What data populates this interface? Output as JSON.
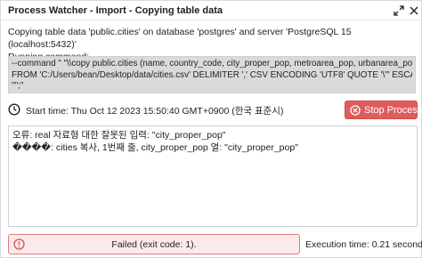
{
  "window": {
    "title": "Process Watcher - Import - Copying table data"
  },
  "description": {
    "line1": "Copying table data 'public.cities' on database 'postgres' and server 'PostgreSQL 15 (localhost:5432)'",
    "line2": "Running command:"
  },
  "command": {
    "line1": "--command \" \"\\\\copy public.cities (name, country_code, city_proper_pop, metroarea_pop, urbanarea_pop)",
    "line2": "FROM 'C:/Users/bean/Desktop/data/cities.csv' DELIMITER ',' CSV ENCODING 'UTF8' QUOTE '\\\"' ESCAPE",
    "line3": "'\"';\""
  },
  "start": {
    "label": "Start time: Thu Oct 12 2023 15:50:40 GMT+0900 (한국 표준시)",
    "icon": "clock-icon"
  },
  "stop_button": {
    "label": "Stop Process",
    "icon": "stop-circle-icon",
    "color": "#df5c5c"
  },
  "output": {
    "lines": [
      "오류: real 자료형 대한 잘못된 입력: \"city_proper_pop\"",
      "����: cities 복사, 1번째 줄, city_proper_pop 열: \"city_proper_pop\""
    ]
  },
  "status": {
    "text": "Failed (exit code: 1).",
    "icon": "error-circle-icon",
    "color": "#e07a7a"
  },
  "execution": {
    "label": "Execution time: 0.21 seconds"
  }
}
